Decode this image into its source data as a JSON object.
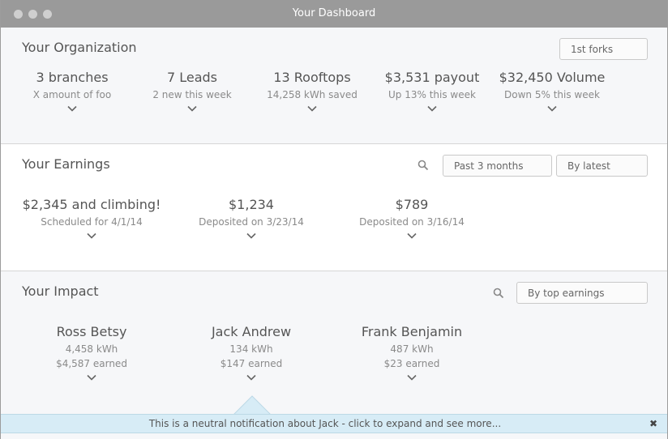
{
  "window": {
    "title": "Your Dashboard"
  },
  "organization": {
    "title": "Your Organization",
    "filter": "1st forks",
    "stats": [
      {
        "value": "3 branches",
        "sub": "X amount of foo"
      },
      {
        "value": "7 Leads",
        "sub": "2 new this week"
      },
      {
        "value": "13 Rooftops",
        "sub": "14,258 kWh saved"
      },
      {
        "value": "$3,531 payout",
        "sub": "Up 13% this week"
      },
      {
        "value": "$32,450 Volume",
        "sub": "Down 5% this week"
      }
    ]
  },
  "earnings": {
    "title": "Your Earnings",
    "period": "Past 3 months",
    "sort": "By latest",
    "items": [
      {
        "value": "$2,345 and climbing!",
        "sub": "Scheduled for 4/1/14"
      },
      {
        "value": "$1,234",
        "sub": "Deposited on 3/23/14"
      },
      {
        "value": "$789",
        "sub": "Deposited on 3/16/14"
      }
    ]
  },
  "impact": {
    "title": "Your Impact",
    "sort": "By top earnings",
    "people": [
      {
        "name": "Ross Betsy",
        "kwh": "4,458 kWh",
        "earned": "$4,587 earned"
      },
      {
        "name": "Jack Andrew",
        "kwh": "134 kWh",
        "earned": "$147 earned"
      },
      {
        "name": "Frank Benjamin",
        "kwh": "487 kWh",
        "earned": "$23 earned"
      }
    ]
  },
  "notification": {
    "message": "This is a neutral notification about Jack - click to expand and see more...",
    "close": "✖"
  },
  "colors": {
    "titlebar": "#9a9a9a",
    "notification": "#d7ecf6",
    "panel": "#f6f7f9"
  }
}
